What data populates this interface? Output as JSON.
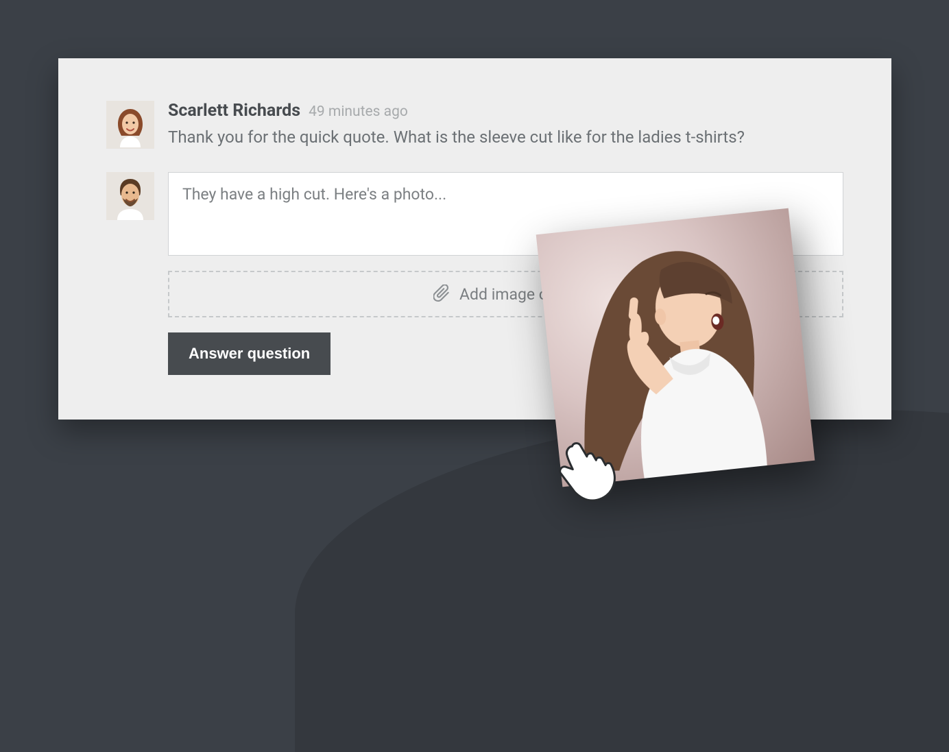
{
  "question": {
    "author": "Scarlett Richards",
    "time": "49 minutes ago",
    "text": "Thank you for the quick quote. What is the sleeve cut like for the ladies t-shirts?"
  },
  "reply": {
    "value": "They have a high cut. Here's a photo..."
  },
  "dropzone": {
    "label": "Add image or file"
  },
  "submit": {
    "label": "Answer question"
  }
}
